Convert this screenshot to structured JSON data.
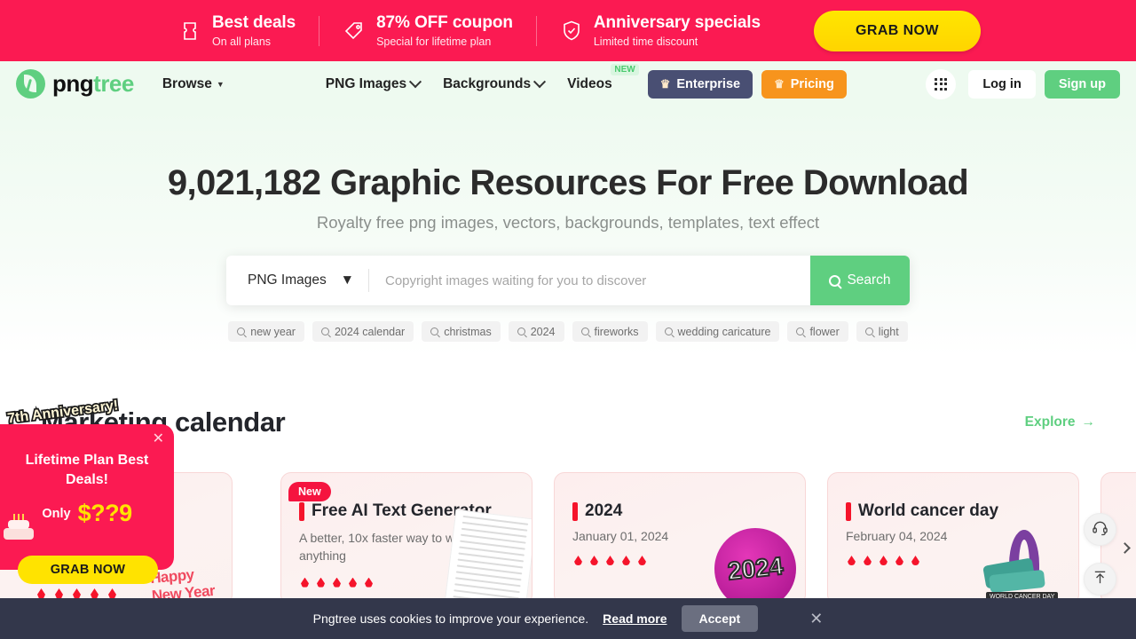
{
  "promo_bar": {
    "items": [
      {
        "icon": "ticket-icon",
        "title": "Best deals",
        "sub": "On all plans"
      },
      {
        "icon": "tag-icon",
        "title": "87% OFF coupon",
        "sub": "Special for lifetime plan"
      },
      {
        "icon": "shield-check-icon",
        "title": "Anniversary specials",
        "sub": "Limited time discount"
      }
    ],
    "cta_label": "GRAB NOW",
    "bg_color": "#fb1a52",
    "cta_color": "#ffe600"
  },
  "header": {
    "logo": {
      "part1": "png",
      "part2": "tree"
    },
    "nav": [
      {
        "label": "Browse",
        "caret": true,
        "badge": ""
      },
      {
        "label": "PNG Images",
        "caret": true,
        "badge": ""
      },
      {
        "label": "Backgrounds",
        "caret": true,
        "badge": ""
      },
      {
        "label": "Videos",
        "caret": false,
        "badge": "NEW"
      }
    ],
    "enterprise_label": "Enterprise",
    "pricing_label": "Pricing",
    "login_label": "Log in",
    "signup_label": "Sign up",
    "accent_green": "#5fcf80",
    "enterprise_color": "#494f73",
    "pricing_color": "#f7941d"
  },
  "hero": {
    "title": "9,021,182 Graphic Resources For Free Download",
    "subtitle": "Royalty free png images, vectors, backgrounds, templates, text effect",
    "search": {
      "category": "PNG Images",
      "placeholder": "Copyright images waiting for you to discover",
      "value": "",
      "button_label": "Search"
    },
    "tags": [
      "new year",
      "2024 calendar",
      "christmas",
      "2024",
      "fireworks",
      "wedding caricature",
      "flower",
      "light"
    ]
  },
  "section": {
    "title": "Marketing calendar",
    "explore_label": "Explore"
  },
  "cards": [
    {
      "badge": "",
      "title": "",
      "subtitle": "",
      "dots": 0,
      "art": "happy-new-year-art"
    },
    {
      "badge": "New",
      "title": "Free AI Text Generator",
      "subtitle": "A better, 10x faster way to write anything",
      "dots": 5,
      "art": "document-art"
    },
    {
      "badge": "",
      "title": "2024",
      "subtitle": "January 01, 2024",
      "dots": 5,
      "art": "2024-badge-art"
    },
    {
      "badge": "",
      "title": "World cancer day",
      "subtitle": "February 04, 2024",
      "dots": 5,
      "art": "cancer-ribbon-art"
    }
  ],
  "popup": {
    "ribbon": "7th Anniversary!",
    "title": "Lifetime Plan Best Deals!",
    "only_label": "Only",
    "price": "$??9",
    "cta_label": "GRAB NOW",
    "bg_color": "#fb1a52",
    "price_color": "#ffe300"
  },
  "cookie": {
    "text": "Pngtree uses cookies to improve your experience.",
    "link_label": "Read more",
    "accept_label": "Accept",
    "bg_color": "#33374b"
  },
  "floats": {
    "support": "headset-icon",
    "back_to_top": "arrow-up-icon",
    "next": "chevron-right-icon"
  }
}
